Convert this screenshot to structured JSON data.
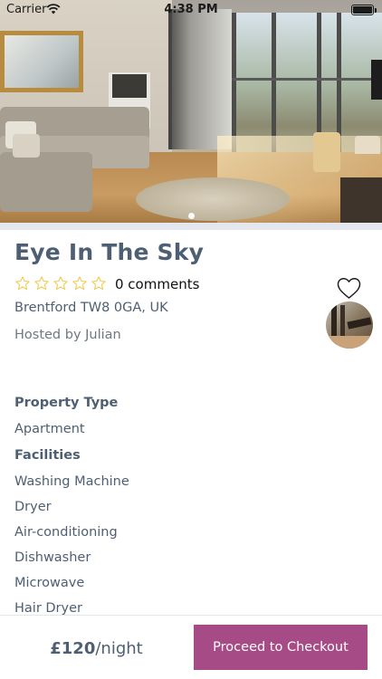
{
  "status_bar": {
    "carrier": "Carrier",
    "time": "4:38 PM",
    "wifi_icon": "wifi-icon",
    "battery_icon": "battery-icon"
  },
  "gallery": {
    "page_indicator_count": 1,
    "current_page": 1
  },
  "listing": {
    "title": "Eye In The Sky",
    "rating": 0,
    "max_rating": 5,
    "comments_label": "0 comments",
    "address": "Brentford TW8 0GA, UK",
    "hosted_by": "Hosted by Julian",
    "favorite_icon": "heart-outline-icon",
    "host_avatar": "host-avatar"
  },
  "details": {
    "property_type_label": "Property Type",
    "property_type_value": "Apartment",
    "facilities_label": "Facilities",
    "facilities": [
      "Washing Machine",
      "Dryer",
      "Air-conditioning",
      "Dishwasher",
      "Microwave",
      "Hair Dryer"
    ]
  },
  "booking": {
    "price_amount": "£120",
    "price_unit": "/night",
    "checkout_label": "Proceed to Checkout"
  },
  "colors": {
    "accent": "#a64b86",
    "text": "#4e5f73",
    "star": "#f2c94c"
  }
}
